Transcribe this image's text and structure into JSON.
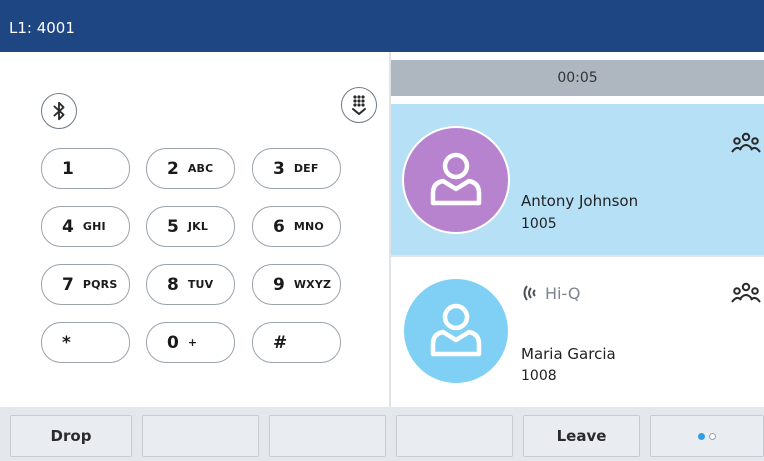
{
  "header": {
    "line_label": "L1: 4001"
  },
  "dialpad": {
    "keys": [
      {
        "num": "1",
        "letters": ""
      },
      {
        "num": "2",
        "letters": "ABC"
      },
      {
        "num": "3",
        "letters": "DEF"
      },
      {
        "num": "4",
        "letters": "GHI"
      },
      {
        "num": "5",
        "letters": "JKL"
      },
      {
        "num": "6",
        "letters": "MNO"
      },
      {
        "num": "7",
        "letters": "PQRS"
      },
      {
        "num": "8",
        "letters": "TUV"
      },
      {
        "num": "9",
        "letters": "WXYZ"
      },
      {
        "num": "*",
        "letters": ""
      },
      {
        "num": "0",
        "letters": "+"
      },
      {
        "num": "#",
        "letters": ""
      }
    ],
    "icons": {
      "bluetooth": "bluetooth-icon",
      "hide_dialpad": "hide-dialpad-icon"
    }
  },
  "call": {
    "timer": "00:05",
    "parties": [
      {
        "name": "Antony Johnson",
        "ext": "1005",
        "avatar_color": "#b783cf",
        "selected": true,
        "icon": "conference-icon"
      },
      {
        "name": "Maria Garcia",
        "ext": "1008",
        "avatar_color": "#7fd0f4",
        "selected": false,
        "badge": "Hi-Q",
        "icon": "conference-icon"
      }
    ]
  },
  "softkeys": {
    "labels": [
      "Drop",
      "",
      "",
      "",
      "Leave"
    ],
    "page_indicator": {
      "current": 1,
      "total": 2
    }
  },
  "colors": {
    "header_bg": "#1d4683",
    "selected_row": "#b6e0f6",
    "page_dot_active": "#2e9ee8"
  }
}
